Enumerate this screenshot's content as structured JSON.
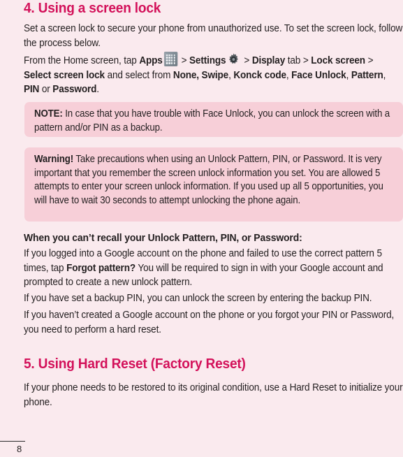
{
  "page": {
    "background_color": "#faeaee",
    "accent_color": "#d3115a",
    "callout_color": "#f7cfd8",
    "text_color": "#231f20",
    "number": "8"
  },
  "section4": {
    "heading": "4. Using a screen lock",
    "intro": "Set a screen lock to secure your phone from unauthorized use. To set the screen lock, follow the process below.",
    "path": {
      "lead": "From the Home screen, tap ",
      "apps_label": "Apps",
      "apps_icon": "apps-grid-icon",
      "sep1": " > ",
      "settings_label": "Settings",
      "settings_icon": "gear-icon",
      "sep2": " > ",
      "display_label": "Display",
      "tab_word": " tab > ",
      "lock_screen_label": "Lock screen",
      "sep3": " > ",
      "select_screen_lock_label": "Select screen lock",
      "mid": " and select from ",
      "options": "None, Swipe",
      "option_knock": "Konck code",
      "option_face": "Face Unlock",
      "option_pattern": "Pattern",
      "option_pin": "PIN",
      "or_word": " or ",
      "option_password": "Password",
      "period": "."
    }
  },
  "note_box": {
    "label": "NOTE:",
    "text": " In case that you have trouble with Face Unlock, you can unlock the screen with a pattern and/or PIN as a backup."
  },
  "warning_box": {
    "label": "Warning!",
    "text": " Take precautions when using an Unlock Pattern, PIN, or Password. It is very important that you remember the screen unlock information you set. You are allowed 5 attempts to enter your screen unlock information. If you used up all 5 opportunities, you will have to wait 30 seconds to attempt unlocking the phone again."
  },
  "recall": {
    "heading": "When you can’t recall your Unlock Pattern, PIN, or Password:",
    "body_part1": "If you logged into a Google account on the phone and failed to use the correct pattern 5 times, tap ",
    "forgot_pattern": "Forgot pattern?",
    "body_part2": " You will be required to sign in with your Google account and prompted to create a new unlock pattern.",
    "backup_pin": "If you have set a backup PIN, you can unlock the screen by entering the backup PIN.",
    "no_google": "If you haven’t created a Google account on the phone or you forgot your PIN or Password, you need to perform a hard reset."
  },
  "section5": {
    "heading": "5. Using Hard Reset (Factory Reset)",
    "body": "If your phone needs to be restored to its original condition, use a Hard Reset to initialize your phone."
  }
}
